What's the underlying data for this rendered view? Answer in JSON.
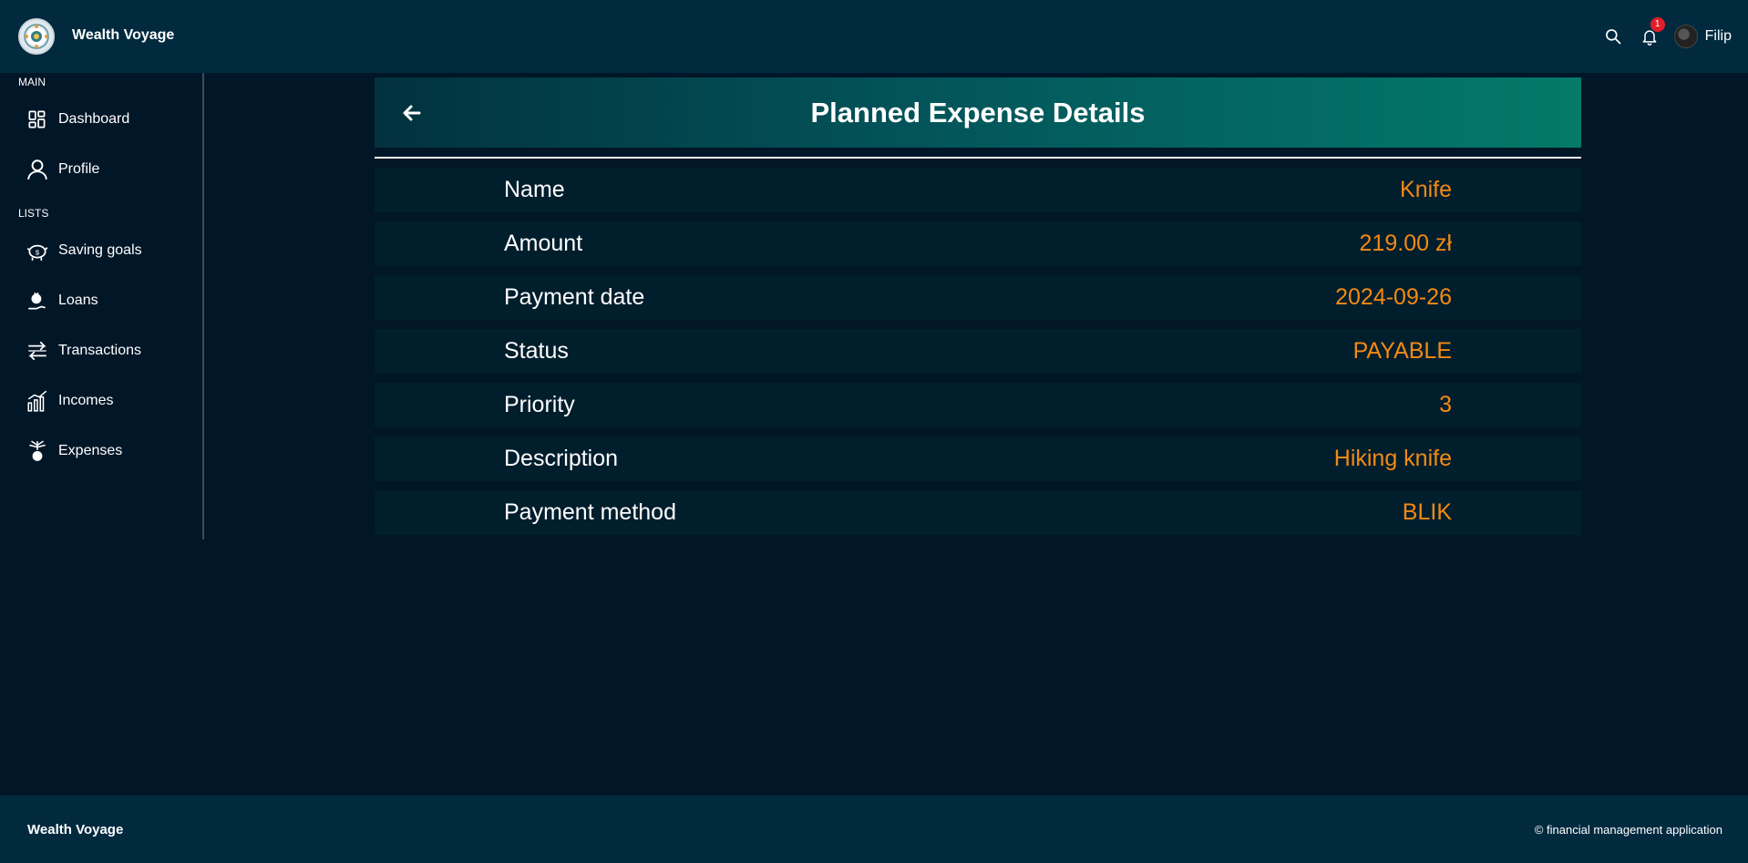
{
  "header": {
    "app_title": "Wealth Voyage",
    "notification_count": "1",
    "username": "Filip",
    "icons": [
      "search-icon",
      "bell-icon",
      "avatar"
    ]
  },
  "sidebar": {
    "sections": [
      {
        "label": "MAIN",
        "items": [
          {
            "label": "Dashboard",
            "icon": "dashboard-icon"
          },
          {
            "label": "Profile",
            "icon": "user-icon"
          }
        ]
      },
      {
        "label": "LISTS",
        "items": [
          {
            "label": "Saving goals",
            "icon": "piggy-bank-icon"
          },
          {
            "label": "Loans",
            "icon": "money-bag-hand-icon"
          },
          {
            "label": "Transactions",
            "icon": "arrows-exchange-icon"
          },
          {
            "label": "Incomes",
            "icon": "bar-growth-icon"
          },
          {
            "label": "Expenses",
            "icon": "money-out-icon"
          }
        ]
      }
    ]
  },
  "main": {
    "title": "Planned Expense Details",
    "details": [
      {
        "label": "Name",
        "value": "Knife"
      },
      {
        "label": "Amount",
        "value": "219.00 zł"
      },
      {
        "label": "Payment date",
        "value": "2024-09-26"
      },
      {
        "label": "Status",
        "value": "PAYABLE"
      },
      {
        "label": "Priority",
        "value": "3"
      },
      {
        "label": "Description",
        "value": "Hiking knife"
      },
      {
        "label": "Payment method",
        "value": "BLIK"
      }
    ]
  },
  "footer": {
    "brand": "Wealth Voyage",
    "copyright": "© financial management application"
  },
  "colors": {
    "background": "#011627",
    "bar": "#012a3f",
    "row": "#011e2d",
    "value": "#f38a12",
    "header_gradient_start": "#02323e",
    "header_gradient_end": "#037a6a",
    "badge": "#e11d2a"
  }
}
